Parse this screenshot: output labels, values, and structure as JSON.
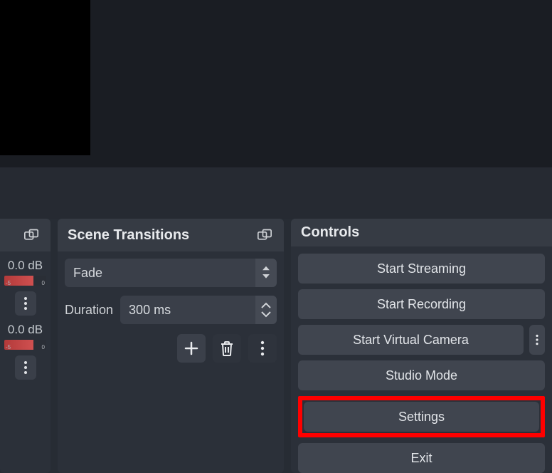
{
  "audio": {
    "channels": [
      {
        "db": "0.0 dB",
        "scale_left": "-5",
        "scale_right": "0"
      },
      {
        "db": "0.0 dB",
        "scale_left": "-5",
        "scale_right": "0"
      }
    ]
  },
  "transitions": {
    "panel_title": "Scene Transitions",
    "selected": "Fade",
    "duration_label": "Duration",
    "duration_value": "300 ms"
  },
  "controls": {
    "panel_title": "Controls",
    "buttons": {
      "start_streaming": "Start Streaming",
      "start_recording": "Start Recording",
      "start_virtual_camera": "Start Virtual Camera",
      "studio_mode": "Studio Mode",
      "settings": "Settings",
      "exit": "Exit"
    }
  }
}
